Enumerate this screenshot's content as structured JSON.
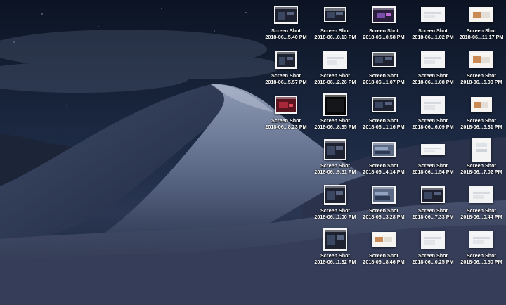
{
  "desktop": {
    "wallpaper": "macOS Mojave Dark",
    "files": [
      {
        "name": "Screen Shot",
        "date": "2018-06...5.40 PM",
        "theme": "dark"
      },
      {
        "name": "Screen Shot",
        "date": "2018-06...0.13 PM",
        "theme": "dark"
      },
      {
        "name": "Screen Shot",
        "date": "2018-06...0.58 PM",
        "theme": "purple"
      },
      {
        "name": "Screen Shot",
        "date": "2018-06...1.02 PM",
        "theme": "light"
      },
      {
        "name": "Screen Shot",
        "date": "2018-06...11.17 PM",
        "theme": "web"
      },
      {
        "name": "Screen Shot",
        "date": "2018-06...5.57 PM",
        "theme": "dark"
      },
      {
        "name": "Screen Shot",
        "date": "2018-06...2.26 PM",
        "theme": "light"
      },
      {
        "name": "Screen Shot",
        "date": "2018-06...1.07 PM",
        "theme": "dark"
      },
      {
        "name": "Screen Shot",
        "date": "2018-06...1.08 PM",
        "theme": "light"
      },
      {
        "name": "Screen Shot",
        "date": "2018-06...5.00 PM",
        "theme": "web"
      },
      {
        "name": "Screen Shot",
        "date": "2018-06...8.23 PM",
        "theme": "red"
      },
      {
        "name": "Screen Shot",
        "date": "2018-06...8.35 PM",
        "theme": "black"
      },
      {
        "name": "Screen Shot",
        "date": "2018-06...1.16 PM",
        "theme": "dark"
      },
      {
        "name": "Screen Shot",
        "date": "2018-06...6.09 PM",
        "theme": "light"
      },
      {
        "name": "Screen Shot",
        "date": "2018-06...5.31 PM",
        "theme": "web"
      },
      {
        "name": "Screen Shot",
        "date": "2018-06...9.51 PM",
        "theme": "dark"
      },
      {
        "name": "Screen Shot",
        "date": "2018-06...4.14 PM",
        "theme": "bluegray"
      },
      {
        "name": "Screen Shot",
        "date": "2018-06...1.54 PM",
        "theme": "light"
      },
      {
        "name": "Screen Shot",
        "date": "2018-06...7.02 PM",
        "theme": "tall"
      },
      {
        "name": "Screen Shot",
        "date": "2018-06...1.00 PM",
        "theme": "dark"
      },
      {
        "name": "Screen Shot",
        "date": "2018-06...3.28 PM",
        "theme": "bluegray"
      },
      {
        "name": "Screen Shot",
        "date": "2018-06...7.33 PM",
        "theme": "dark"
      },
      {
        "name": "Screen Shot",
        "date": "2018-06...0.44 PM",
        "theme": "light"
      },
      {
        "name": "Screen Shot",
        "date": "2018-06...1.32 PM",
        "theme": "dark"
      },
      {
        "name": "Screen Shot",
        "date": "2018-06...8.46 PM",
        "theme": "web"
      },
      {
        "name": "Screen Shot",
        "date": "2018-06...0.25 PM",
        "theme": "light"
      },
      {
        "name": "Screen Shot",
        "date": "2018-06...0.50 PM",
        "theme": "light"
      }
    ]
  }
}
